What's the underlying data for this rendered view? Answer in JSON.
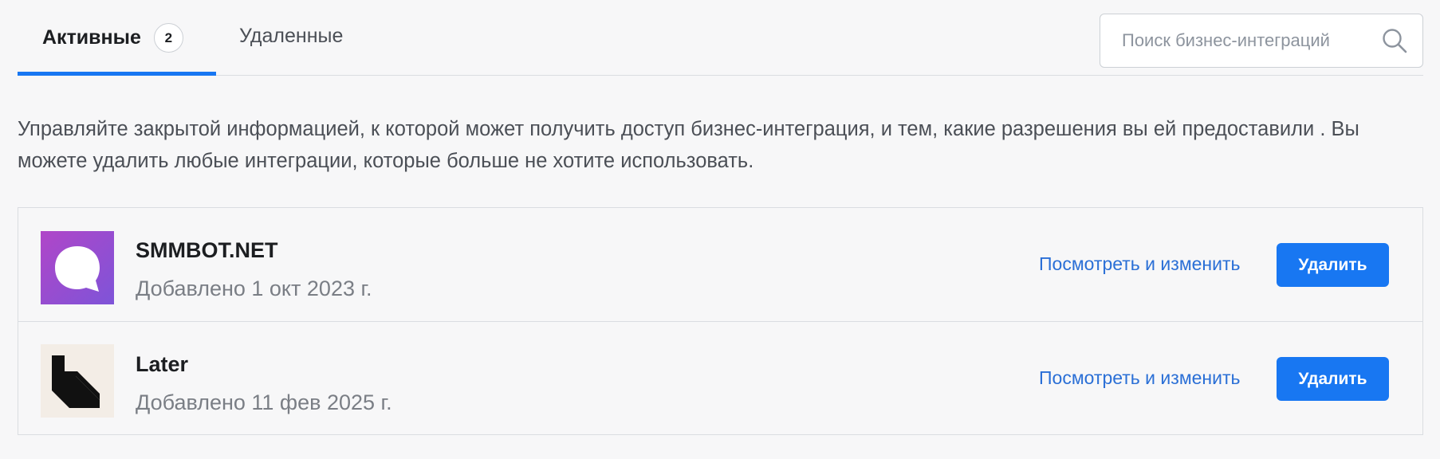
{
  "tabs": {
    "active": {
      "label": "Активные",
      "count": "2"
    },
    "deleted": {
      "label": "Удаленные"
    }
  },
  "search": {
    "placeholder": "Поиск бизнес-интеграций",
    "value": "",
    "icon": "search-icon"
  },
  "description": "Управляйте закрытой информацией, к которой может получить доступ бизнес-интеграция, и тем, какие разрешения вы ей предоставили . Вы можете удалить любые интеграции, которые больше не хотите использовать.",
  "integrations": [
    {
      "name": "SMMBOT.NET",
      "added": "Добавлено 1 окт 2023 г.",
      "logo": "chat-bubble-logo",
      "logo_colors": [
        "#b046c8",
        "#7e54d8"
      ],
      "view_label": "Посмотреть и изменить",
      "delete_label": "Удалить"
    },
    {
      "name": "Later",
      "added": "Добавлено 11 фев 2025 г.",
      "logo": "later-logo",
      "logo_colors": [
        "#f3ede6",
        "#111111"
      ],
      "view_label": "Посмотреть и изменить",
      "delete_label": "Удалить"
    }
  ],
  "colors": {
    "accent": "#1877f2",
    "link": "#2a6fd6",
    "background": "#f7f7f8",
    "border": "#dadde1"
  }
}
